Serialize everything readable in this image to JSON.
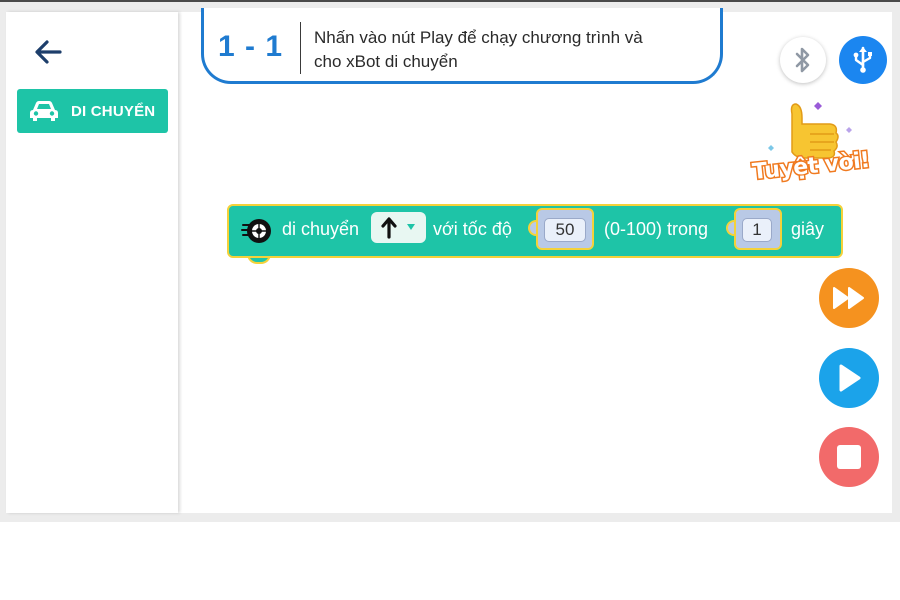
{
  "header": {
    "back_icon": "arrow-left-icon",
    "task_number": "1 - 1",
    "task_line1": "Nhấn vào nút Play để chạy chương trình và",
    "task_line2": "cho xBot di chuyển"
  },
  "sidebar": {
    "category_label": "DI CHUYỂN",
    "category_icon": "car-icon",
    "category_color": "#1ec4a7"
  },
  "badge": {
    "text": "Tuyệt vời!"
  },
  "block": {
    "icon": "wheel-icon",
    "label_move": "di chuyển",
    "direction_icon": "arrow-up-icon",
    "label_speed": "với tốc độ",
    "speed_value": "50",
    "label_range": "(0-100) trong",
    "duration_value": "1",
    "label_unit": "giây",
    "block_color": "#1ec4a7",
    "border_color": "#f4d23a"
  },
  "controls": {
    "bluetooth_icon": "bluetooth-icon",
    "usb_icon": "usb-icon",
    "fast_forward_icon": "fast-forward-icon",
    "play_icon": "play-icon",
    "stop_icon": "stop-icon",
    "usb_color": "#1b86f0",
    "ff_color": "#f5921f",
    "play_color": "#1ba3ea",
    "stop_color": "#f26a6a"
  }
}
